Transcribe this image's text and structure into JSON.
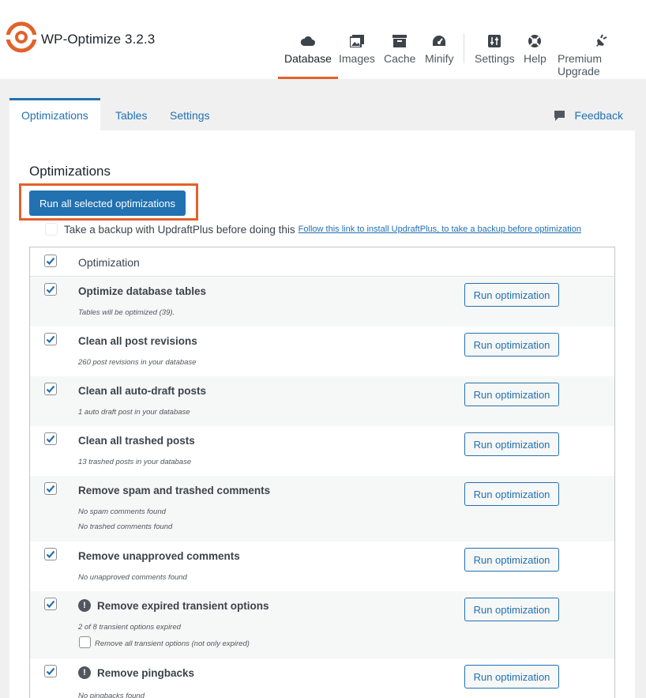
{
  "header": {
    "brand": "WP-Optimize 3.2.3",
    "nav": [
      {
        "label": "Database",
        "icon": "cloud-icon",
        "active": true
      },
      {
        "label": "Images",
        "icon": "images-icon"
      },
      {
        "label": "Cache",
        "icon": "archive-icon"
      },
      {
        "label": "Minify",
        "icon": "dashboard-icon"
      },
      {
        "label": "Settings",
        "icon": "sliders-icon"
      },
      {
        "label": "Help",
        "icon": "lifebuoy-icon"
      },
      {
        "label": "Premium Upgrade",
        "icon": "plugin-icon"
      }
    ]
  },
  "subtabs": {
    "optimizations": "Optimizations",
    "tables": "Tables",
    "settings": "Settings",
    "feedback": "Feedback"
  },
  "main": {
    "heading": "Optimizations",
    "run_all_label": "Run all selected optimizations",
    "backup_text": "Take a backup with UpdraftPlus before doing this",
    "backup_link": "Follow this link to install UpdraftPlus, to take a backup before optimization",
    "table_header": "Optimization",
    "run_label": "Run optimization",
    "rows": [
      {
        "title": "Optimize database tables",
        "notes": [
          "Tables will be optimized (39)."
        ]
      },
      {
        "title": "Clean all post revisions",
        "notes": [
          "260 post revisions in your database"
        ]
      },
      {
        "title": "Clean all auto-draft posts",
        "notes": [
          "1 auto draft post in your database"
        ]
      },
      {
        "title": "Clean all trashed posts",
        "notes": [
          "13 trashed posts in your database"
        ]
      },
      {
        "title": "Remove spam and trashed comments",
        "notes": [
          "No spam comments found",
          "No trashed comments found"
        ]
      },
      {
        "title": "Remove unapproved comments",
        "notes": [
          "No unapproved comments found"
        ]
      },
      {
        "title": "Remove expired transient options",
        "warning": true,
        "notes": [
          "2 of 8 transient options expired"
        ],
        "extra_checkbox": "Remove all transient options (not only expired)"
      },
      {
        "title": "Remove pingbacks",
        "warning": true,
        "notes": [
          "No pingbacks found"
        ]
      }
    ]
  },
  "colors": {
    "accent": "#e2622a",
    "primary": "#2271b1"
  }
}
